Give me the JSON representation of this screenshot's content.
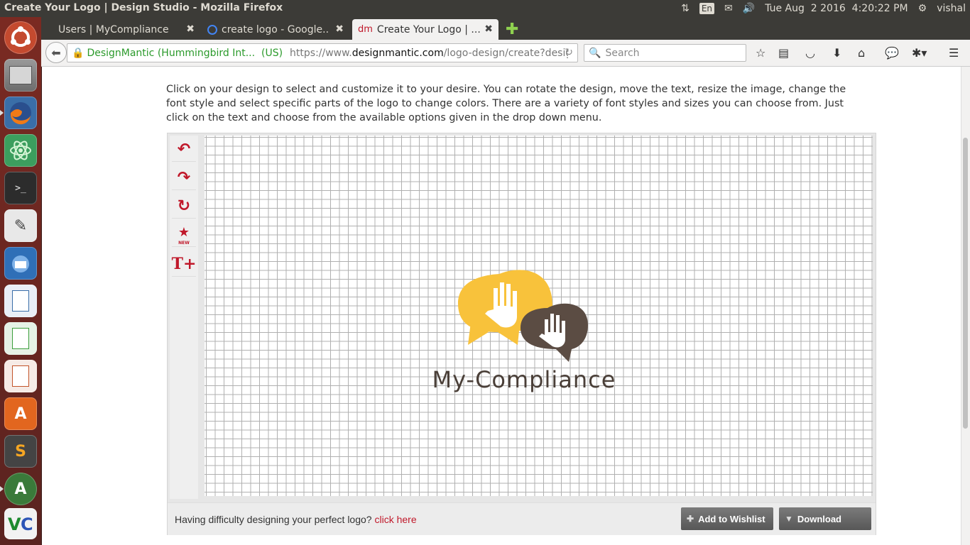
{
  "window": {
    "title": "Create Your Logo | Design Studio - Mozilla Firefox"
  },
  "tray": {
    "keyboard": "En",
    "datetime": "Tue Aug  2 2016  4:20:22 PM",
    "user": "vishal"
  },
  "launcher": {
    "items": [
      "ubuntu-dash",
      "files",
      "firefox",
      "atom",
      "terminal",
      "text-editor",
      "thunderbird",
      "writer",
      "calc",
      "impress",
      "software-center",
      "sublime-text",
      "update-manager",
      "vlc"
    ]
  },
  "tabs": [
    {
      "label": "Users | MyCompliance",
      "active": false
    },
    {
      "label": "create logo - Google...",
      "active": false
    },
    {
      "label": "Create Your Logo | ...",
      "active": true,
      "favicon": "dm"
    }
  ],
  "navbar": {
    "identity": "DesignMantic (Hummingbird Int...  (US)",
    "url_prefix": "https://www.",
    "url_domain": "designmantic.com",
    "url_path": "/logo-design/create?desigr",
    "search_placeholder": "Search"
  },
  "page": {
    "instructions": "Click on your design to select and customize it to your desire. You can rotate the design, move the text, resize the image, change the font style and select specific parts of the logo to change colors. There are a variety of font styles and sizes you can choose from. Just click on the text and choose from the available options given in the drop down menu.",
    "tools": [
      "undo",
      "redo",
      "reset",
      "new-symbol",
      "add-text"
    ],
    "tool_new_label": "NEW",
    "logo_text": "My-Compliance",
    "help_text": "Having difficulty designing your perfect logo?",
    "help_link": "click here",
    "wishlist_label": "Add to Wishlist",
    "download_label": "Download"
  },
  "colors": {
    "accent": "#c0182a",
    "logo_yellow": "#f8c23b",
    "logo_brown": "#5b4c43"
  }
}
